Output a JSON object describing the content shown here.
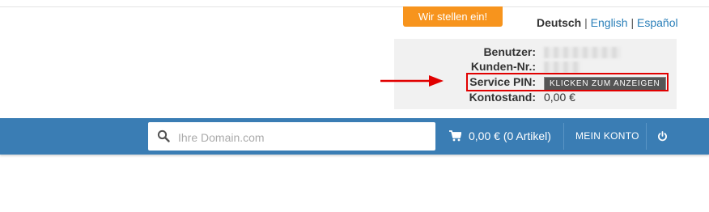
{
  "header": {
    "jobs_badge": "Wir stellen ein!",
    "languages": {
      "active": "Deutsch",
      "sep1": "|",
      "english": "English",
      "sep2": "|",
      "spanish": "Español"
    }
  },
  "account_box": {
    "user_label": "Benutzer:",
    "customer_label": "Kunden-Nr.:",
    "pin_label": "Service PIN:",
    "pin_button": "KLICKEN ZUM ANZEIGEN",
    "balance_label": "Kontostand:",
    "balance_value": "0,00 €"
  },
  "navbar": {
    "search_placeholder": "Ihre Domain.com",
    "cart": "0,00 € (0 Artikel)",
    "my_account": "MEIN KONTO"
  },
  "colors": {
    "navbar": "#3a7db4",
    "jobs_badge": "#f7941d",
    "highlight": "#e10000",
    "link": "#2a7fb9"
  },
  "icons": {
    "search": "search-icon",
    "cart": "cart-icon",
    "power": "power-icon",
    "arrow": "arrow-icon"
  }
}
